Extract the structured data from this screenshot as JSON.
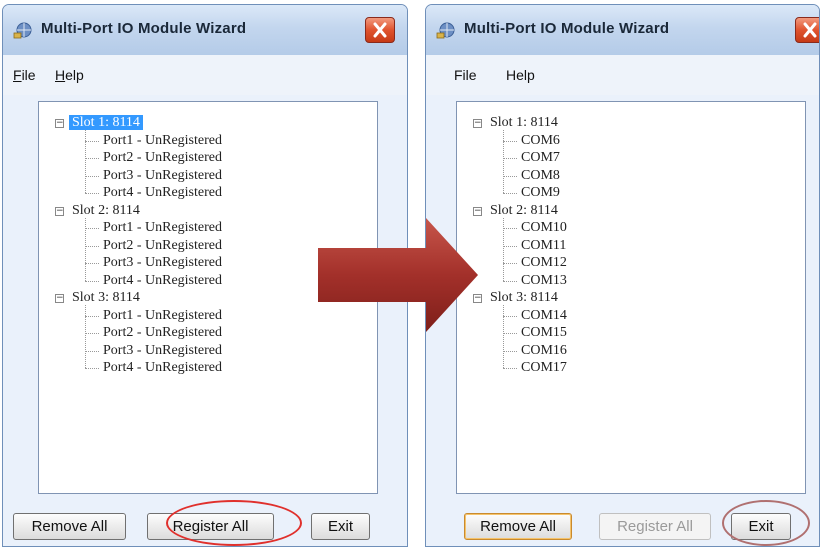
{
  "windows": [
    {
      "title": "Multi-Port IO Module Wizard",
      "menu": [
        "File",
        "Help"
      ],
      "tree": [
        {
          "label": "Slot 1: 8114",
          "selected": true,
          "children": [
            "Port1 - UnRegistered",
            "Port2 - UnRegistered",
            "Port3 - UnRegistered",
            "Port4 - UnRegistered"
          ]
        },
        {
          "label": "Slot 2: 8114",
          "selected": false,
          "children": [
            "Port1 - UnRegistered",
            "Port2 - UnRegistered",
            "Port3 - UnRegistered",
            "Port4 - UnRegistered"
          ]
        },
        {
          "label": "Slot 3: 8114",
          "selected": false,
          "children": [
            "Port1 - UnRegistered",
            "Port2 - UnRegistered",
            "Port3 - UnRegistered",
            "Port4 - UnRegistered"
          ]
        }
      ],
      "buttons": {
        "remove": "Remove All",
        "register": "Register All",
        "exit": "Exit"
      },
      "register_enabled": true,
      "highlighted_button": "register"
    },
    {
      "title": "Multi-Port IO Module Wizard",
      "menu": [
        "File",
        "Help"
      ],
      "tree": [
        {
          "label": "Slot 1: 8114",
          "selected": false,
          "children": [
            "COM6",
            "COM7",
            "COM8",
            "COM9"
          ]
        },
        {
          "label": "Slot 2: 8114",
          "selected": false,
          "children": [
            "COM10",
            "COM11",
            "COM12",
            "COM13"
          ]
        },
        {
          "label": "Slot 3: 8114",
          "selected": false,
          "children": [
            "COM14",
            "COM15",
            "COM16",
            "COM17"
          ]
        }
      ],
      "buttons": {
        "remove": "Remove All",
        "register": "Register All",
        "exit": "Exit"
      },
      "register_enabled": false,
      "highlighted_button": "exit"
    }
  ],
  "colors": {
    "callout": "#e0302c",
    "arrow": "#9e2a22",
    "selection": "#3399ff",
    "close_button": "#d9441f"
  },
  "icons": {
    "app": "network-globe-icon",
    "close": "close-icon",
    "expander": "tree-collapse-icon",
    "transition": "right-arrow-icon"
  }
}
